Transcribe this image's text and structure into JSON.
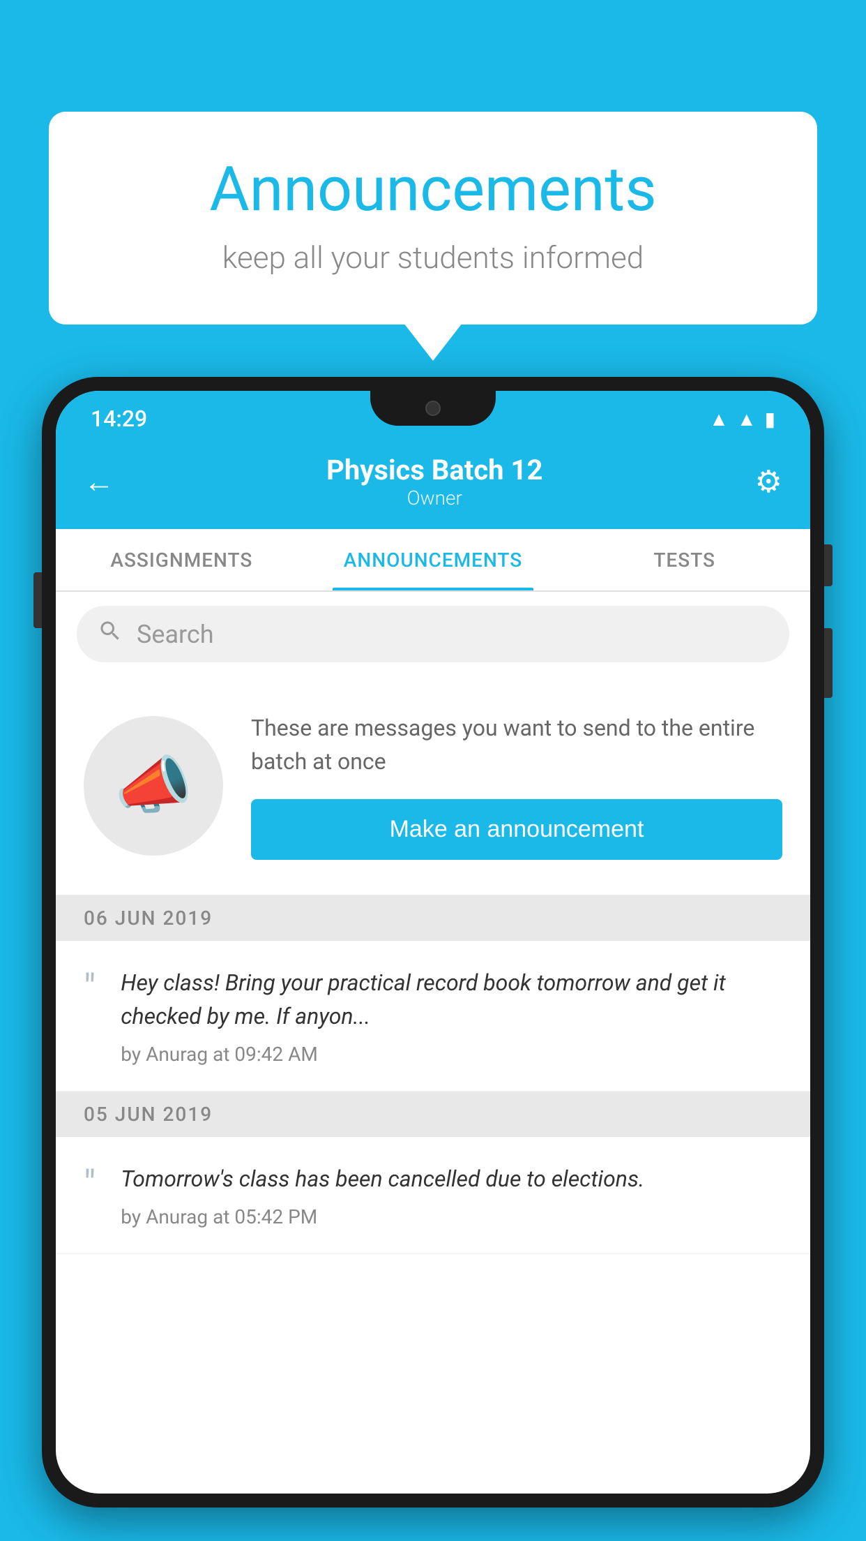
{
  "page": {
    "background_color": "#1ab9e8"
  },
  "speech_bubble": {
    "title": "Announcements",
    "subtitle": "keep all your students informed"
  },
  "status_bar": {
    "time": "14:29",
    "icons": [
      "wifi",
      "signal",
      "battery"
    ]
  },
  "header": {
    "title": "Physics Batch 12",
    "subtitle": "Owner",
    "back_label": "←",
    "settings_label": "⚙"
  },
  "tabs": [
    {
      "label": "ASSIGNMENTS",
      "active": false
    },
    {
      "label": "ANNOUNCEMENTS",
      "active": true
    },
    {
      "label": "TESTS",
      "active": false
    }
  ],
  "search": {
    "placeholder": "Search"
  },
  "promo": {
    "description": "These are messages you want to send to the entire batch at once",
    "button_label": "Make an announcement"
  },
  "announcements": [
    {
      "date": "06  JUN  2019",
      "text": "Hey class! Bring your practical record book tomorrow and get it checked by me. If anyon...",
      "meta": "by Anurag at 09:42 AM"
    },
    {
      "date": "05  JUN  2019",
      "text": "Tomorrow's class has been cancelled due to elections.",
      "meta": "by Anurag at 05:42 PM"
    }
  ]
}
